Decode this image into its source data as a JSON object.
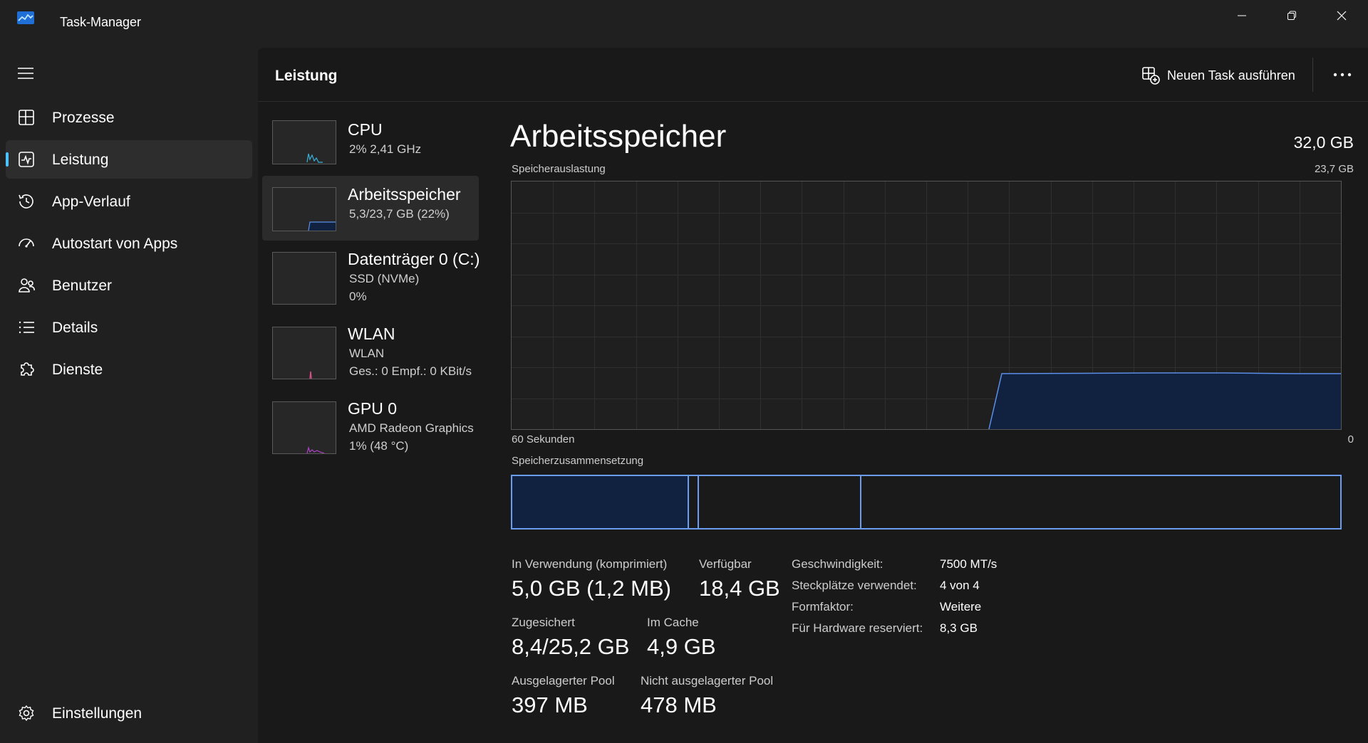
{
  "window": {
    "title": "Task-Manager",
    "minimize_icon": "minimize-icon",
    "maximize_icon": "restore-icon",
    "close_icon": "close-icon"
  },
  "nav": {
    "items": [
      {
        "label": "Prozesse",
        "icon": "processes-grid-icon"
      },
      {
        "label": "Leistung",
        "icon": "performance-chart-icon",
        "active": true
      },
      {
        "label": "App-Verlauf",
        "icon": "history-clock-icon"
      },
      {
        "label": "Autostart von Apps",
        "icon": "speedometer-icon"
      },
      {
        "label": "Benutzer",
        "icon": "users-icon"
      },
      {
        "label": "Details",
        "icon": "details-list-icon"
      },
      {
        "label": "Dienste",
        "icon": "services-puzzle-icon"
      }
    ],
    "settings_label": "Einstellungen"
  },
  "header": {
    "title": "Leistung",
    "run_task_label": "Neuen Task ausführen"
  },
  "devices": [
    {
      "name": "CPU",
      "line1": "2%  2,41 GHz",
      "line2": "",
      "spark_color": "#3ab0d8"
    },
    {
      "name": "Arbeitsspeicher",
      "line1": "5,3/23,7 GB (22%)",
      "line2": "",
      "spark_color": "#5a8ee8",
      "active": true
    },
    {
      "name": "Datenträger 0 (C:)",
      "line1": "SSD (NVMe)",
      "line2": "0%",
      "spark_color": "#60b040"
    },
    {
      "name": "WLAN",
      "line1": "WLAN",
      "line2": "Ges.: 0  Empf.: 0 KBit/s",
      "spark_color": "#d8508a"
    },
    {
      "name": "GPU 0",
      "line1": "AMD Radeon Graphics",
      "line2": "1%  (48 °C)",
      "spark_color": "#b040c8"
    }
  ],
  "detail": {
    "title": "Arbeitsspeicher",
    "total": "32,0 GB",
    "usage_label": "Speicherauslastung",
    "usage_max": "23,7 GB",
    "x_left": "60 Sekunden",
    "x_right": "0",
    "composition_label": "Speicherzusammensetzung",
    "usage_fraction": 0.22,
    "accent": "#6a9cf0",
    "fill": "#112240"
  },
  "stats": {
    "in_use_label": "In Verwendung (komprimiert)",
    "in_use_value": "5,0 GB (1,2 MB)",
    "available_label": "Verfügbar",
    "available_value": "18,4 GB",
    "committed_label": "Zugesichert",
    "committed_value": "8,4/25,2 GB",
    "cached_label": "Im Cache",
    "cached_value": "4,9 GB",
    "paged_label": "Ausgelagerter Pool",
    "paged_value": "397 MB",
    "nonpaged_label": "Nicht ausgelagerter Pool",
    "nonpaged_value": "478 MB"
  },
  "specs": [
    {
      "label": "Geschwindigkeit:",
      "value": "7500 MT/s"
    },
    {
      "label": "Steckplätze verwendet:",
      "value": "4 von 4"
    },
    {
      "label": "Formfaktor:",
      "value": "Weitere"
    },
    {
      "label": "Für Hardware reserviert:",
      "value": "8,3 GB"
    }
  ]
}
